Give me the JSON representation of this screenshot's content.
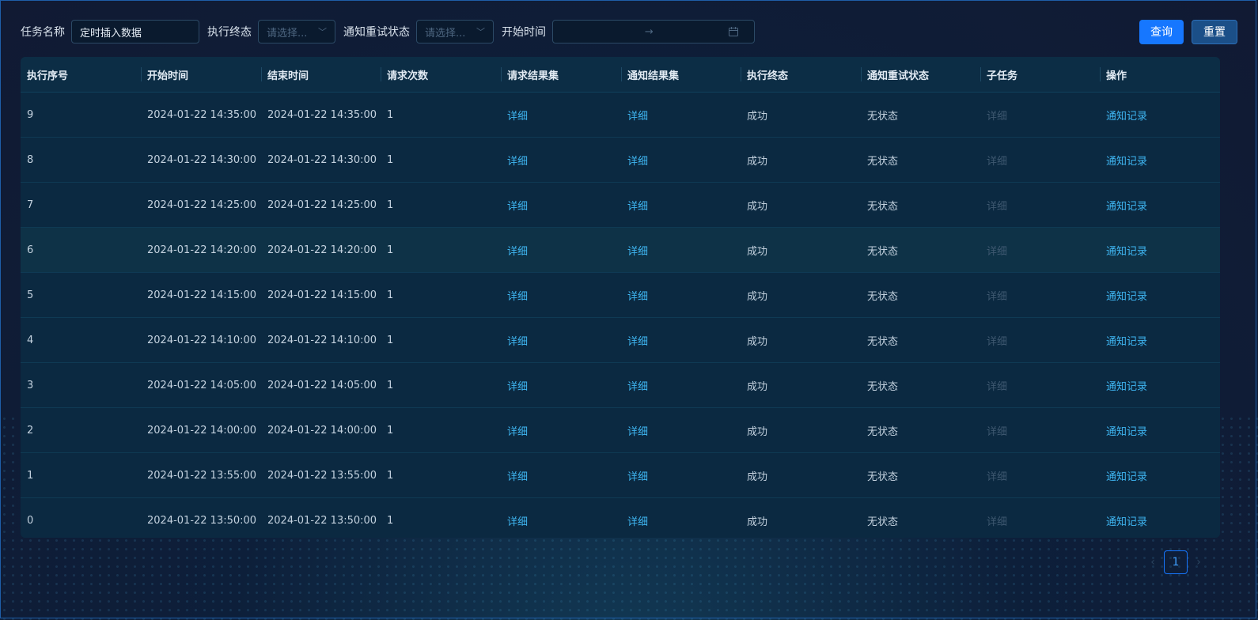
{
  "filters": {
    "task_name_label": "任务名称",
    "task_name_value": "定时插入数据",
    "exec_status_label": "执行终态",
    "exec_status_placeholder": "请选择...",
    "retry_status_label": "通知重试状态",
    "retry_status_placeholder": "请选择...",
    "start_time_label": "开始时间",
    "range_separator": "→"
  },
  "buttons": {
    "query": "查询",
    "reset": "重置"
  },
  "table": {
    "columns": [
      "执行序号",
      "开始时间",
      "结束时间",
      "请求次数",
      "请求结果集",
      "通知结果集",
      "执行终态",
      "通知重试状态",
      "子任务",
      "操作"
    ],
    "rows": [
      {
        "id": "9",
        "start": "2024-01-22 14:35:00",
        "end": "2024-01-22 14:35:00",
        "count": "1",
        "req": "详细",
        "notify": "详细",
        "status": "成功",
        "retry": "无状态",
        "sub": "详细",
        "op": "通知记录"
      },
      {
        "id": "8",
        "start": "2024-01-22 14:30:00",
        "end": "2024-01-22 14:30:00",
        "count": "1",
        "req": "详细",
        "notify": "详细",
        "status": "成功",
        "retry": "无状态",
        "sub": "详细",
        "op": "通知记录"
      },
      {
        "id": "7",
        "start": "2024-01-22 14:25:00",
        "end": "2024-01-22 14:25:00",
        "count": "1",
        "req": "详细",
        "notify": "详细",
        "status": "成功",
        "retry": "无状态",
        "sub": "详细",
        "op": "通知记录"
      },
      {
        "id": "6",
        "start": "2024-01-22 14:20:00",
        "end": "2024-01-22 14:20:00",
        "count": "1",
        "req": "详细",
        "notify": "详细",
        "status": "成功",
        "retry": "无状态",
        "sub": "详细",
        "op": "通知记录"
      },
      {
        "id": "5",
        "start": "2024-01-22 14:15:00",
        "end": "2024-01-22 14:15:00",
        "count": "1",
        "req": "详细",
        "notify": "详细",
        "status": "成功",
        "retry": "无状态",
        "sub": "详细",
        "op": "通知记录"
      },
      {
        "id": "4",
        "start": "2024-01-22 14:10:00",
        "end": "2024-01-22 14:10:00",
        "count": "1",
        "req": "详细",
        "notify": "详细",
        "status": "成功",
        "retry": "无状态",
        "sub": "详细",
        "op": "通知记录"
      },
      {
        "id": "3",
        "start": "2024-01-22 14:05:00",
        "end": "2024-01-22 14:05:00",
        "count": "1",
        "req": "详细",
        "notify": "详细",
        "status": "成功",
        "retry": "无状态",
        "sub": "详细",
        "op": "通知记录"
      },
      {
        "id": "2",
        "start": "2024-01-22 14:00:00",
        "end": "2024-01-22 14:00:00",
        "count": "1",
        "req": "详细",
        "notify": "详细",
        "status": "成功",
        "retry": "无状态",
        "sub": "详细",
        "op": "通知记录"
      },
      {
        "id": "1",
        "start": "2024-01-22 13:55:00",
        "end": "2024-01-22 13:55:00",
        "count": "1",
        "req": "详细",
        "notify": "详细",
        "status": "成功",
        "retry": "无状态",
        "sub": "详细",
        "op": "通知记录"
      },
      {
        "id": "0",
        "start": "2024-01-22 13:50:00",
        "end": "2024-01-22 13:50:00",
        "count": "1",
        "req": "详细",
        "notify": "详细",
        "status": "成功",
        "retry": "无状态",
        "sub": "详细",
        "op": "通知记录"
      }
    ]
  },
  "pagination": {
    "current": "1",
    "prev_icon": "chevron-left-icon",
    "next_icon": "chevron-right-icon"
  },
  "colors": {
    "accent": "#1677ff",
    "link": "#3fb6f2",
    "table_bg": "#0a2a40"
  }
}
